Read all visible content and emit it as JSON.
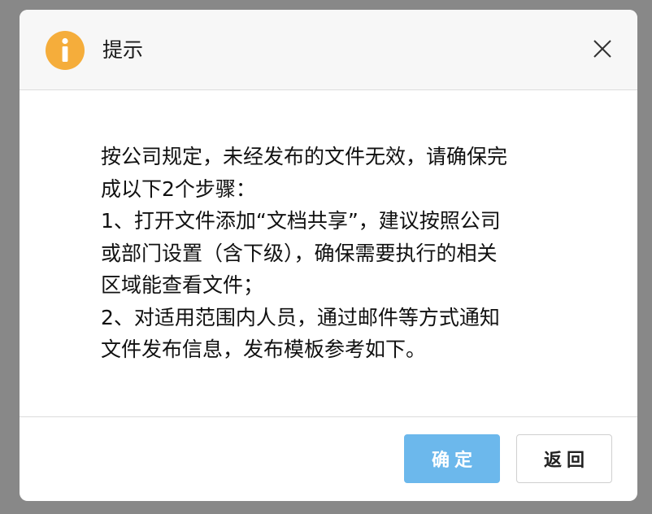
{
  "dialog": {
    "title": "提示",
    "icon": "info-icon",
    "close_icon": "close-icon",
    "message_lines": [
      "按公司规定，未经发布的文件无效，请确保完",
      "成以下2个步骤：",
      "1、打开文件添加“文档共享”，建议按照公司",
      "或部门设置（含下级），确保需要执行的相关",
      "区域能查看文件；",
      "2、对适用范围内人员，通过邮件等方式通知",
      "文件发布信息，发布模板参考如下。"
    ],
    "buttons": {
      "confirm_label": "确定",
      "back_label": "返回"
    }
  },
  "colors": {
    "icon_accent": "#f5ad3b",
    "confirm_button": "#6cb8ec",
    "header_background": "#f7f7f7"
  }
}
